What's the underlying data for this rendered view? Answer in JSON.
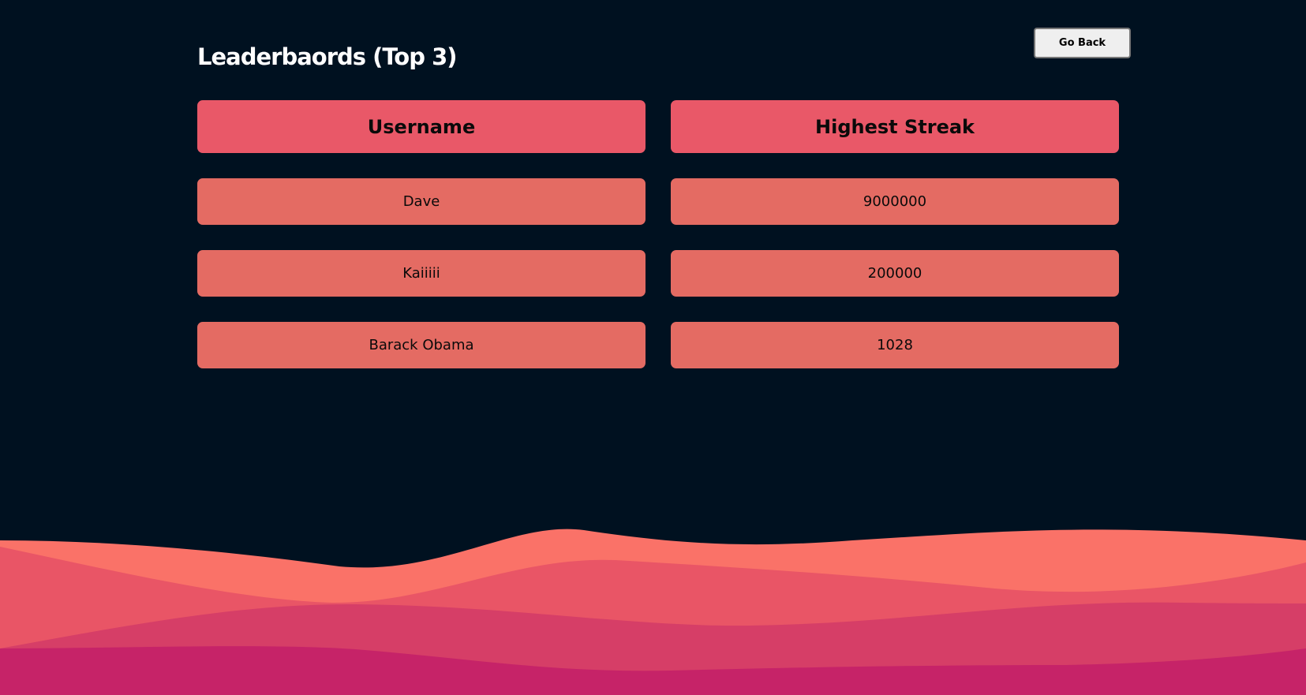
{
  "page": {
    "title": "Leaderbaords (Top 3)",
    "go_back_label": "Go Back"
  },
  "table": {
    "headers": [
      "Username",
      "Highest Streak"
    ],
    "rows": [
      {
        "username": "Dave",
        "streak": "9000000"
      },
      {
        "username": "Kaiiiii",
        "streak": "200000"
      },
      {
        "username": "Barack Obama",
        "streak": "1028"
      }
    ]
  },
  "colors": {
    "background": "#001120",
    "header_cell": "#e95868",
    "row_cell": "#e46b63",
    "wave_1": "#fa7268",
    "wave_2": "#e95566",
    "wave_3": "#d63e67",
    "wave_4": "#c62368"
  }
}
